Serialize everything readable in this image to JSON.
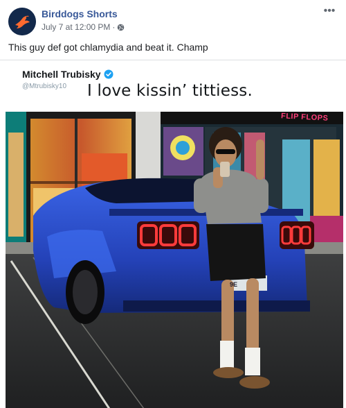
{
  "post": {
    "page_name": "Birddogs Shorts",
    "timestamp": "July 7 at 12:00 PM",
    "separator": "·",
    "privacy_icon": "globe-icon",
    "more_label": "•••",
    "text": "This guy def got chlamydia and beat it. Champ"
  },
  "tweet": {
    "author_name": "Mitchell Trubisky",
    "handle": "@Mtrubisky10",
    "verified_icon": "verified-badge-icon",
    "text": "I love kissin’ tittiess."
  },
  "photo": {
    "store_sign": "FLIP FLOPS",
    "plate": "9E"
  },
  "colors": {
    "brand_link": "#385898",
    "avatar_bg": "#13294b",
    "verified": "#1da1f2",
    "car_blue": "#2f55d6"
  }
}
